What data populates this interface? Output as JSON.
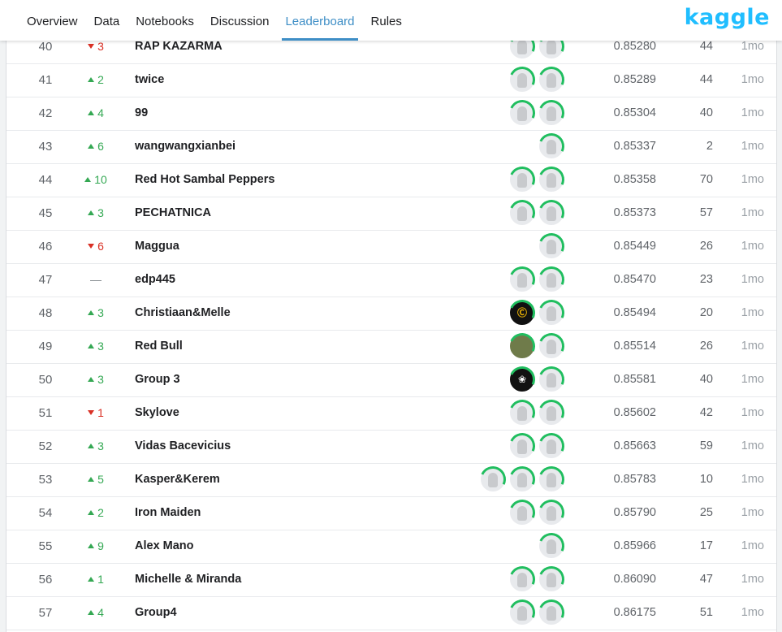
{
  "nav": {
    "items": [
      "Overview",
      "Data",
      "Notebooks",
      "Discussion",
      "Leaderboard",
      "Rules"
    ],
    "active": "Leaderboard"
  },
  "logo": "kaggle",
  "colors": {
    "accent": "#3e8ec6",
    "up": "#34a853",
    "down": "#d93025",
    "logo": "#20beff"
  },
  "rows": [
    {
      "rank": "40",
      "dir": "down",
      "change": "3",
      "team": "RAP KAZARMA",
      "avatars": [
        "goose",
        "goose"
      ],
      "score": "0.85280",
      "entries": "44",
      "last": "1mo"
    },
    {
      "rank": "41",
      "dir": "up",
      "change": "2",
      "team": "twice",
      "avatars": [
        "goose",
        "goose"
      ],
      "score": "0.85289",
      "entries": "44",
      "last": "1mo"
    },
    {
      "rank": "42",
      "dir": "up",
      "change": "4",
      "team": "99",
      "avatars": [
        "goose",
        "goose"
      ],
      "score": "0.85304",
      "entries": "40",
      "last": "1mo"
    },
    {
      "rank": "43",
      "dir": "up",
      "change": "6",
      "team": "wangwangxianbei",
      "avatars": [
        "goose"
      ],
      "score": "0.85337",
      "entries": "2",
      "last": "1mo"
    },
    {
      "rank": "44",
      "dir": "up",
      "change": "10",
      "team": "Red Hot Sambal Peppers",
      "avatars": [
        "goose",
        "goose"
      ],
      "score": "0.85358",
      "entries": "70",
      "last": "1mo"
    },
    {
      "rank": "45",
      "dir": "up",
      "change": "3",
      "team": "PECHATNICA",
      "avatars": [
        "goose",
        "goose"
      ],
      "score": "0.85373",
      "entries": "57",
      "last": "1mo"
    },
    {
      "rank": "46",
      "dir": "down",
      "change": "6",
      "team": "Maggua",
      "avatars": [
        "goose"
      ],
      "score": "0.85449",
      "entries": "26",
      "last": "1mo"
    },
    {
      "rank": "47",
      "dir": "same",
      "change": "—",
      "team": "edp445",
      "avatars": [
        "goose",
        "goose"
      ],
      "score": "0.85470",
      "entries": "23",
      "last": "1mo"
    },
    {
      "rank": "48",
      "dir": "up",
      "change": "3",
      "team": "Christiaan&Melle",
      "avatars": [
        "dark-c",
        "goose"
      ],
      "score": "0.85494",
      "entries": "20",
      "last": "1mo"
    },
    {
      "rank": "49",
      "dir": "up",
      "change": "3",
      "team": "Red Bull",
      "avatars": [
        "photo",
        "goose"
      ],
      "score": "0.85514",
      "entries": "26",
      "last": "1mo"
    },
    {
      "rank": "50",
      "dir": "up",
      "change": "3",
      "team": "Group 3",
      "avatars": [
        "dark-fish",
        "goose"
      ],
      "score": "0.85581",
      "entries": "40",
      "last": "1mo"
    },
    {
      "rank": "51",
      "dir": "down",
      "change": "1",
      "team": "Skylove",
      "avatars": [
        "goose",
        "goose"
      ],
      "score": "0.85602",
      "entries": "42",
      "last": "1mo"
    },
    {
      "rank": "52",
      "dir": "up",
      "change": "3",
      "team": "Vidas Bacevicius",
      "avatars": [
        "goose",
        "goose"
      ],
      "score": "0.85663",
      "entries": "59",
      "last": "1mo"
    },
    {
      "rank": "53",
      "dir": "up",
      "change": "5",
      "team": "Kasper&Kerem",
      "avatars": [
        "goose",
        "goose",
        "goose"
      ],
      "score": "0.85783",
      "entries": "10",
      "last": "1mo"
    },
    {
      "rank": "54",
      "dir": "up",
      "change": "2",
      "team": "Iron Maiden",
      "avatars": [
        "goose",
        "goose"
      ],
      "score": "0.85790",
      "entries": "25",
      "last": "1mo"
    },
    {
      "rank": "55",
      "dir": "up",
      "change": "9",
      "team": "Alex Mano",
      "avatars": [
        "goose"
      ],
      "score": "0.85966",
      "entries": "17",
      "last": "1mo"
    },
    {
      "rank": "56",
      "dir": "up",
      "change": "1",
      "team": "Michelle & Miranda",
      "avatars": [
        "goose",
        "goose"
      ],
      "score": "0.86090",
      "entries": "47",
      "last": "1mo"
    },
    {
      "rank": "57",
      "dir": "up",
      "change": "4",
      "team": "Group4",
      "avatars": [
        "goose",
        "goose"
      ],
      "score": "0.86175",
      "entries": "51",
      "last": "1mo"
    }
  ]
}
